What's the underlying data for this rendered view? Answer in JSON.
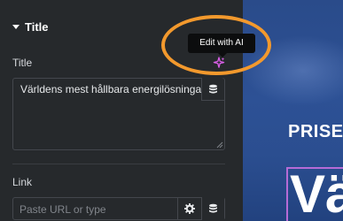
{
  "section": {
    "title": "Title"
  },
  "title_field": {
    "label": "Title",
    "value": "Världens mest hållbara energilösningar"
  },
  "tooltip": {
    "text": "Edit with AI"
  },
  "link_field": {
    "label": "Link",
    "placeholder": "Paste URL or type"
  },
  "preview": {
    "eyebrow": "PRISE",
    "heading": "Vä"
  },
  "icons": {
    "section_toggle": "caret-down-icon",
    "ai": "sparkle-icon",
    "dynamic": "database-icon",
    "settings": "gear-icon"
  },
  "colors": {
    "panel_bg": "#26292c",
    "highlight": "#f3992d",
    "ai_accent": "#d95ee6",
    "preview_bg": "#2d5195"
  }
}
